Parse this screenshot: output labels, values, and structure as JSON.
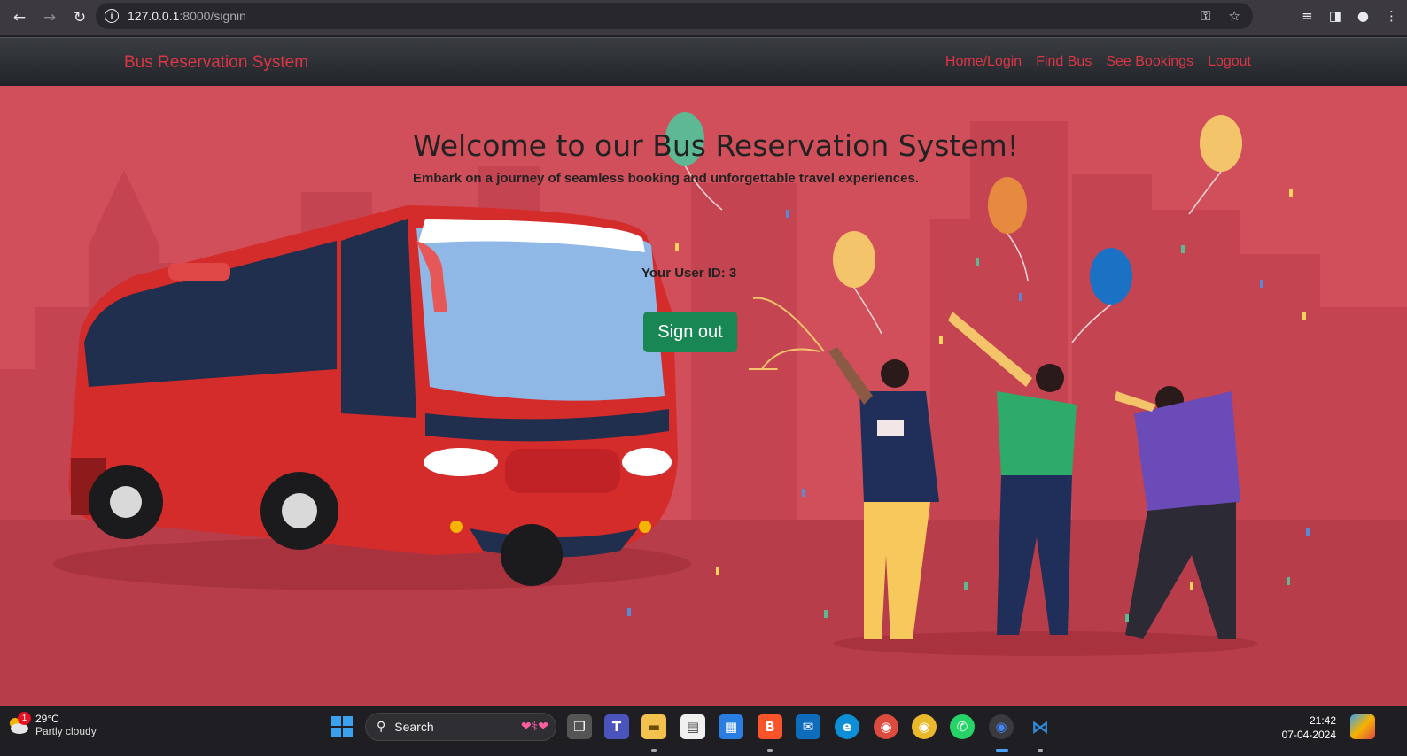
{
  "browser": {
    "url_host": "127.0.0.1",
    "url_path": ":8000/signin"
  },
  "navbar": {
    "brand": "Bus Reservation System",
    "links": [
      "Home/Login",
      "Find Bus",
      "See Bookings",
      "Logout"
    ]
  },
  "hero": {
    "title": "Welcome to our Bus Reservation System!",
    "subtitle": "Embark on a journey of seamless booking and unforgettable travel experiences.",
    "user_id_label": "Your User ID: 3",
    "signout_label": "Sign out"
  },
  "taskbar": {
    "weather_temp": "29°C",
    "weather_cond": "Partly cloudy",
    "weather_badge": "1",
    "search_placeholder": "Search",
    "time": "21:42",
    "date": "07-04-2024"
  },
  "colors": {
    "accent_red": "#dc3545",
    "signout_green": "#198754",
    "hero_bg": "#d14f5a"
  }
}
